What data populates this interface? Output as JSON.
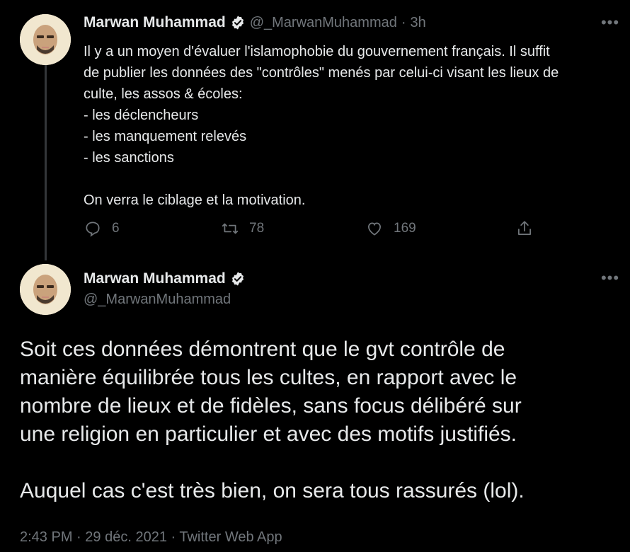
{
  "tweet1": {
    "author": "Marwan Muhammad",
    "handle": "@_MarwanMuhammad",
    "separator": "·",
    "time": "3h",
    "text": "Il y a un moyen d'évaluer l'islamophobie du gouvernement français. Il suffit\nde publier les données des \"contrôles\" menés par celui-ci visant les lieux de\nculte, les assos & écoles:\n- les déclencheurs\n- les manquement relevés\n- les sanctions\n\nOn verra le ciblage et la motivation.",
    "replies": "6",
    "retweets": "78",
    "likes": "169"
  },
  "tweet2": {
    "author": "Marwan Muhammad",
    "handle": "@_MarwanMuhammad",
    "text": "Soit ces données démontrent que le gvt contrôle de\nmanière équilibrée tous les cultes, en rapport avec le\nnombre de lieux et de fidèles, sans focus délibéré sur\nune religion en particulier et avec des motifs justifiés.\n\nAuquel cas c'est très bien, on sera tous rassurés (lol).",
    "time": "2:43 PM",
    "date": "29 déc. 2021",
    "source": "Twitter Web App",
    "separator": "·"
  },
  "icons": {
    "more": "more-horizontal-icon",
    "verified": "verified-badge-icon",
    "reply": "reply-icon",
    "retweet": "retweet-icon",
    "like": "heart-icon",
    "share": "share-icon"
  },
  "colors": {
    "background": "#000000",
    "text": "#e7e9ea",
    "secondary": "#71767b",
    "thread_line": "#333639"
  }
}
